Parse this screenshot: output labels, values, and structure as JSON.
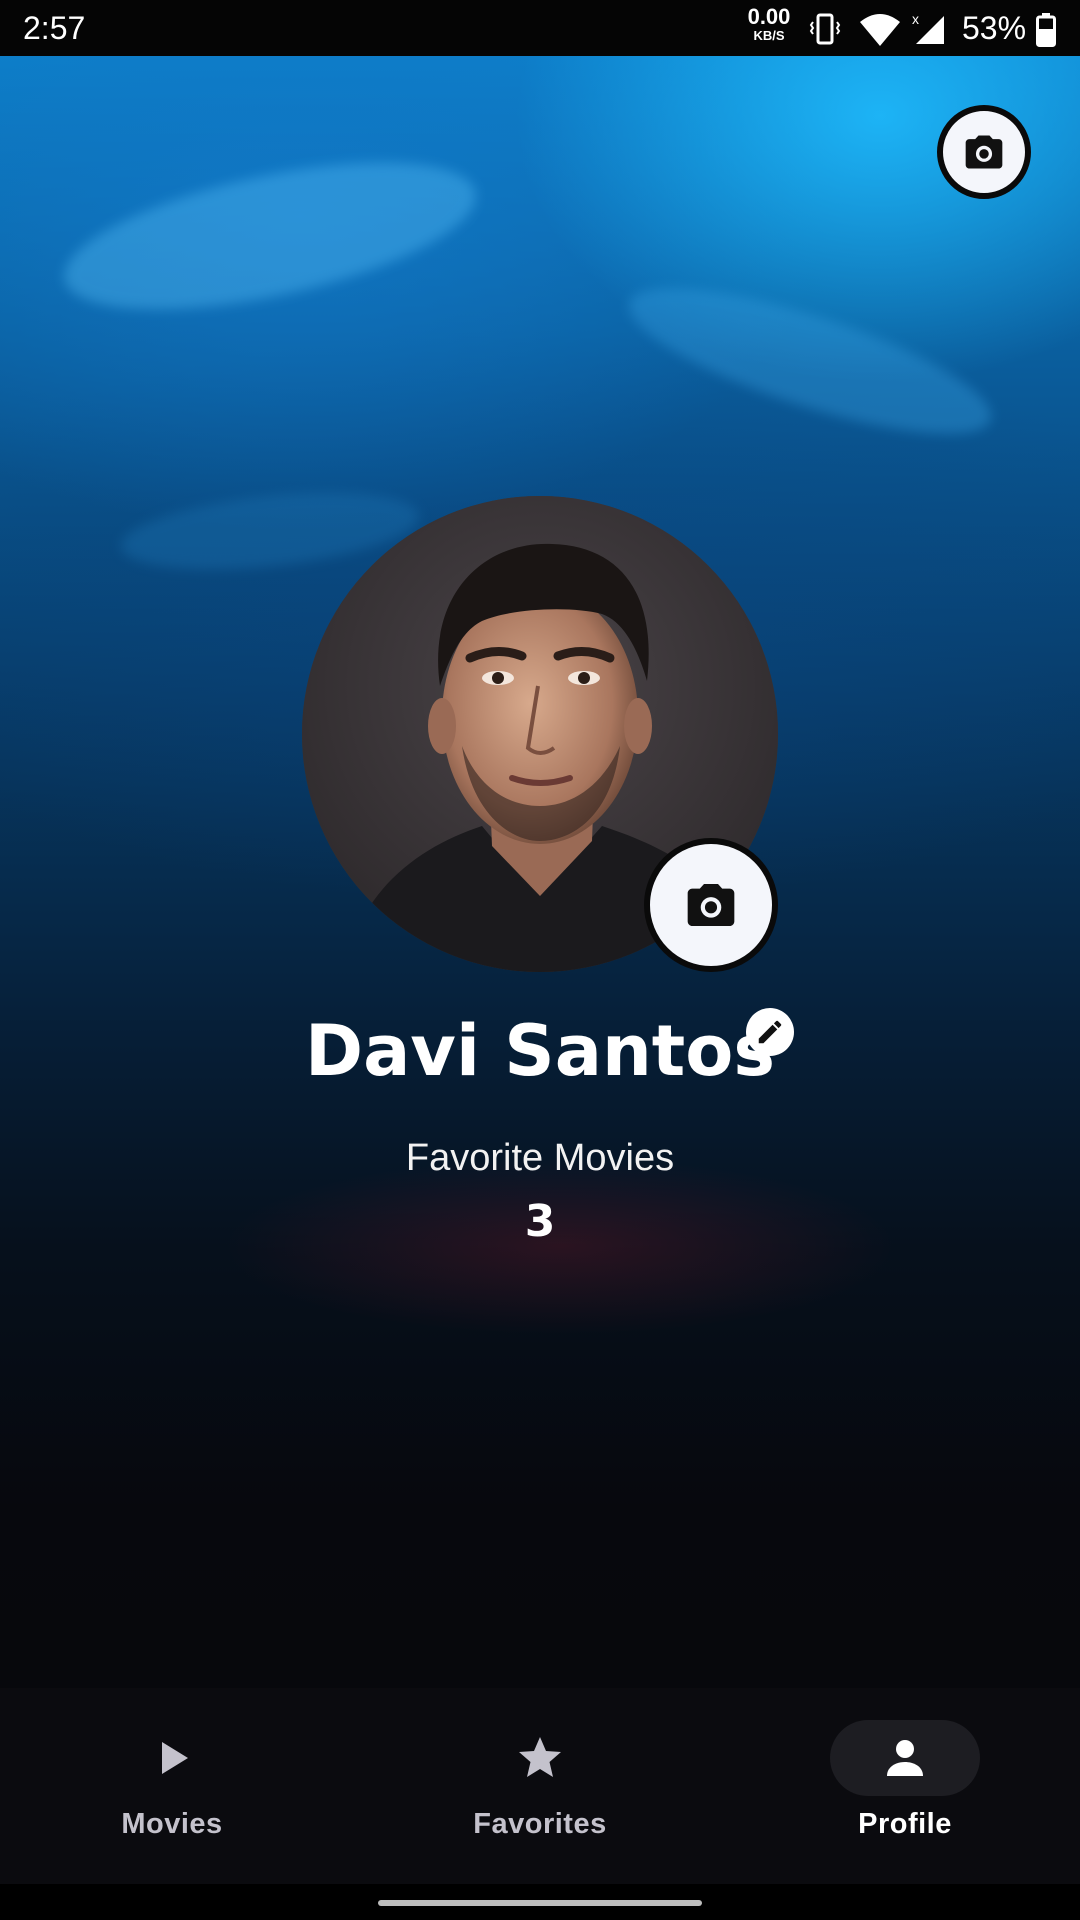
{
  "status_bar": {
    "time": "2:57",
    "net_speed_value": "0.00",
    "net_speed_unit": "KB/S",
    "battery_percent": "53%",
    "icons": [
      "vibrate-icon",
      "wifi-icon",
      "signal-icon",
      "battery-icon"
    ]
  },
  "profile": {
    "name": "Davi Santos",
    "favorites_label": "Favorite Movies",
    "favorites_count": "3",
    "cover_camera_icon": "camera-icon",
    "avatar_camera_icon": "camera-icon",
    "edit_icon": "pencil-icon"
  },
  "bottom_nav": {
    "items": [
      {
        "label": "Movies",
        "icon": "play-icon",
        "active": false
      },
      {
        "label": "Favorites",
        "icon": "star-icon",
        "active": false
      },
      {
        "label": "Profile",
        "icon": "person-icon",
        "active": true
      }
    ]
  },
  "colors": {
    "background": "#07080d",
    "sky_accent": "#20beff",
    "active_pill": "#1d1d22",
    "nav_label": "#c4c2cc",
    "text_primary": "#ffffff"
  }
}
